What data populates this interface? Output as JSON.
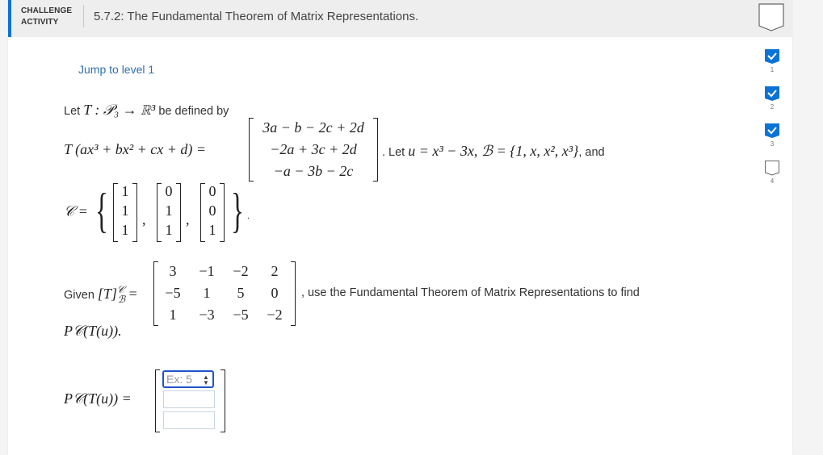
{
  "header": {
    "label_line1": "CHALLENGE",
    "label_line2": "ACTIVITY",
    "title": "5.7.2: The Fundamental Theorem of Matrix Representations.",
    "accent_color": "#0a73d6"
  },
  "levels": {
    "items": [
      {
        "number": "1",
        "status": "completed"
      },
      {
        "number": "2",
        "status": "completed"
      },
      {
        "number": "3",
        "status": "completed"
      },
      {
        "number": "4",
        "status": "incomplete"
      }
    ],
    "completed_color": "#0a73d6"
  },
  "jump_link": "Jump to level 1",
  "problem": {
    "intro_let": "Let",
    "intro_map": "T : 𝒫₃ → ℝ³",
    "intro_tail": "be defined by",
    "T_lhs": "T (ax³ + bx² + cx + d) =",
    "T_rows": [
      "3a − b − 2c + 2d",
      "−2a + 3c + 2d",
      "−a − 3b − 2c"
    ],
    "let_text": ". Let",
    "u_def": "u = x³ − 3x, ℬ = {1, x, x², x³}",
    "and_text": ", and",
    "C_label": "𝒞 =",
    "C_vectors": [
      [
        "1",
        "1",
        "1"
      ],
      [
        "0",
        "1",
        "1"
      ],
      [
        "0",
        "0",
        "1"
      ]
    ],
    "given_text": "Given",
    "TBC_label": "[T]",
    "TBC_sup": "𝒞",
    "TBC_sub": "ℬ",
    "matrix": [
      [
        "3",
        "−1",
        "−2",
        "2"
      ],
      [
        "−5",
        "1",
        "5",
        "0"
      ],
      [
        "1",
        "−3",
        "−5",
        "−2"
      ]
    ],
    "use_text": ", use the Fundamental Theorem of Matrix Representations to find",
    "target": "P𝒞(T(u)).",
    "answer_label": "P𝒞(T(u)) ="
  },
  "answer_inputs": [
    {
      "value": "",
      "placeholder": "Ex: 5"
    },
    {
      "value": "",
      "placeholder": ""
    },
    {
      "value": "",
      "placeholder": ""
    }
  ]
}
